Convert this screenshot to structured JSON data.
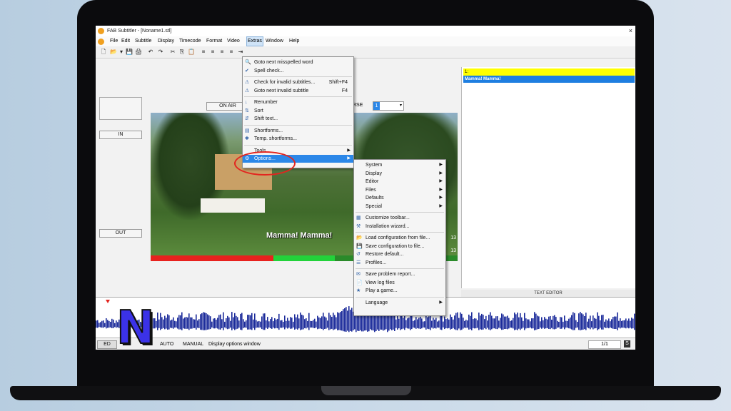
{
  "app": {
    "title": "FAB Subtitler - [Noname1.stl]",
    "close_glyph": "×"
  },
  "menubar": [
    "File",
    "Edit",
    "Subtitle",
    "Display",
    "Timecode",
    "Format",
    "Video",
    "Extras",
    "Window",
    "Help"
  ],
  "toolbar_icons": [
    "new-file-icon",
    "open-folder-icon",
    "dropdown-icon",
    "save-icon",
    "print-icon",
    "undo-icon",
    "redo-icon",
    "cut-icon",
    "copy-icon",
    "paste-icon",
    "align-left-icon",
    "align-center-icon",
    "align-right-icon",
    "justify-icon",
    "indent-icon"
  ],
  "toolbar_glyphs": [
    "🗋",
    "📂",
    "▾",
    "💾",
    "🖨",
    "↶",
    "↷",
    "✂",
    "⎘",
    "📋",
    "≡",
    "≡",
    "≡",
    "≡",
    "⇥"
  ],
  "controls": {
    "on_air": "ON AIR",
    "in": "IN",
    "out": "OUT",
    "rse_label": "RSE",
    "rse_value": "1"
  },
  "video": {
    "subtitle_text": "Mamma! Mamma!",
    "num_a": "13",
    "num_b": "13"
  },
  "subtitle_panel": {
    "row_number": "1:",
    "row_text": "Mamma! Mamma!",
    "editor_label": "TEXT EDITOR"
  },
  "status": {
    "ed": "ED",
    "auto": "AUTO",
    "manual": "MANUAL",
    "message": "Display options window",
    "page": "1/1",
    "s_btn": "S"
  },
  "extras_menu": [
    {
      "icon": "spell-check-icon",
      "glyph": "🔍",
      "label": "Goto next misspelled word",
      "shortcut": ""
    },
    {
      "icon": "spell-check-icon",
      "glyph": "✔",
      "label": "Spell check...",
      "shortcut": ""
    },
    {
      "sep": true
    },
    {
      "icon": "warning-icon",
      "glyph": "⚠",
      "label": "Check for invalid subtitles...",
      "shortcut": "Shift+F4"
    },
    {
      "icon": "warning-icon",
      "glyph": "⚠",
      "label": "Goto next invalid subtitle",
      "shortcut": "F4"
    },
    {
      "sep": true
    },
    {
      "icon": "renumber-icon",
      "glyph": "↓",
      "label": "Renumber",
      "shortcut": ""
    },
    {
      "icon": "sort-icon",
      "glyph": "⇅",
      "label": "Sort",
      "shortcut": ""
    },
    {
      "icon": "shift-icon",
      "glyph": "⇵",
      "label": "Shift text...",
      "shortcut": ""
    },
    {
      "sep": true
    },
    {
      "icon": "shortforms-icon",
      "glyph": "▤",
      "label": "Shortforms...",
      "shortcut": ""
    },
    {
      "icon": "temp-shortforms-icon",
      "glyph": "✱",
      "label": "Temp. shortforms...",
      "shortcut": ""
    },
    {
      "sep": true
    },
    {
      "icon": "",
      "glyph": "",
      "label": "Tools",
      "shortcut": "",
      "submenu": true
    },
    {
      "icon": "options-icon",
      "glyph": "⚙",
      "label": "Options...",
      "shortcut": "",
      "submenu": true,
      "highlight": true
    }
  ],
  "options_submenu": [
    {
      "label": "System",
      "submenu": true
    },
    {
      "label": "Display",
      "submenu": true
    },
    {
      "label": "Editor",
      "submenu": true
    },
    {
      "label": "Files",
      "submenu": true
    },
    {
      "label": "Defaults",
      "submenu": true
    },
    {
      "label": "Special",
      "submenu": true
    },
    {
      "sep": true
    },
    {
      "icon": "toolbar-icon",
      "glyph": "▦",
      "label": "Customize toolbar..."
    },
    {
      "icon": "wizard-icon",
      "glyph": "⚒",
      "label": "Installation wizard..."
    },
    {
      "sep": true
    },
    {
      "icon": "load-config-icon",
      "glyph": "📂",
      "label": "Load configuration from file..."
    },
    {
      "icon": "save-config-icon",
      "glyph": "💾",
      "label": "Save configuration to file..."
    },
    {
      "icon": "restore-icon",
      "glyph": "↺",
      "label": "Restore default..."
    },
    {
      "icon": "profiles-icon",
      "glyph": "☰",
      "label": "Profiles..."
    },
    {
      "sep": true
    },
    {
      "icon": "report-icon",
      "glyph": "✉",
      "label": "Save problem report..."
    },
    {
      "icon": "log-icon",
      "glyph": "📄",
      "label": "View log files"
    },
    {
      "icon": "game-icon",
      "glyph": "★",
      "label": "Play a game..."
    },
    {
      "sep": true
    },
    {
      "label": "Language",
      "submenu": true
    }
  ],
  "overlay": {
    "logo_letter": "N"
  }
}
